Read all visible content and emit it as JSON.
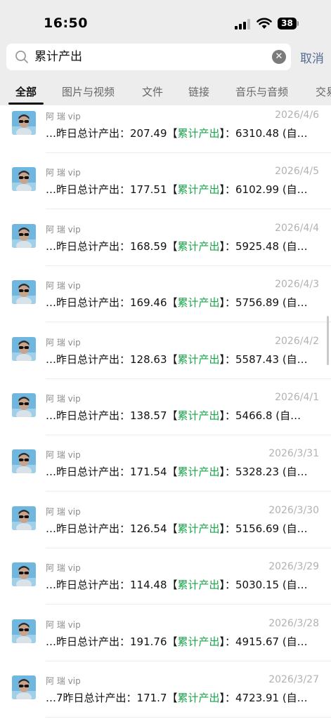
{
  "status_bar": {
    "time": "16:50",
    "battery": "38"
  },
  "search": {
    "query": "累计产出",
    "cancel_label": "取消"
  },
  "tabs": [
    "全部",
    "图片与视频",
    "文件",
    "链接",
    "音乐与音频",
    "交易"
  ],
  "active_tab": "全部",
  "colors": {
    "highlight": "#19a64b",
    "cancel": "#576b95",
    "date": "#b2b2b2"
  },
  "results": [
    {
      "sender": "阿 瑞 vip",
      "date": "2026/4/6",
      "prefix": "…昨日总计产出：207.49【",
      "keyword": "累计产出",
      "suffix": "】：6310.48 (自…"
    },
    {
      "sender": "阿 瑞 vip",
      "date": "2026/4/5",
      "prefix": "…昨日总计产出：177.51【",
      "keyword": "累计产出",
      "suffix": "】：6102.99 (自…"
    },
    {
      "sender": "阿 瑞 vip",
      "date": "2026/4/4",
      "prefix": "…昨日总计产出：168.59【",
      "keyword": "累计产出",
      "suffix": "】：5925.48 (自…"
    },
    {
      "sender": "阿 瑞 vip",
      "date": "2026/4/3",
      "prefix": "…昨日总计产出：169.46【",
      "keyword": "累计产出",
      "suffix": "】：5756.89 (自…"
    },
    {
      "sender": "阿 瑞 vip",
      "date": "2026/4/2",
      "prefix": "…昨日总计产出：128.63【",
      "keyword": "累计产出",
      "suffix": "】：5587.43 (自…"
    },
    {
      "sender": "阿 瑞 vip",
      "date": "2026/4/1",
      "prefix": "…昨日总计产出：138.57【",
      "keyword": "累计产出",
      "suffix": "】：5466.8 (自…"
    },
    {
      "sender": "阿 瑞 vip",
      "date": "2026/3/31",
      "prefix": "…昨日总计产出：171.54【",
      "keyword": "累计产出",
      "suffix": "】：5328.23 (自…"
    },
    {
      "sender": "阿 瑞 vip",
      "date": "2026/3/30",
      "prefix": "…昨日总计产出：126.54【",
      "keyword": "累计产出",
      "suffix": "】：5156.69 (自…"
    },
    {
      "sender": "阿 瑞 vip",
      "date": "2026/3/29",
      "prefix": "…昨日总计产出：114.48【",
      "keyword": "累计产出",
      "suffix": "】：5030.15 (自…"
    },
    {
      "sender": "阿 瑞 vip",
      "date": "2026/3/28",
      "prefix": "…昨日总计产出：191.76【",
      "keyword": "累计产出",
      "suffix": "】：4915.67 (自…"
    },
    {
      "sender": "阿 瑞 vip",
      "date": "2026/3/27",
      "prefix": "…7昨日总计产出：171.7【",
      "keyword": "累计产出",
      "suffix": "】：4723.91 (自…"
    }
  ]
}
